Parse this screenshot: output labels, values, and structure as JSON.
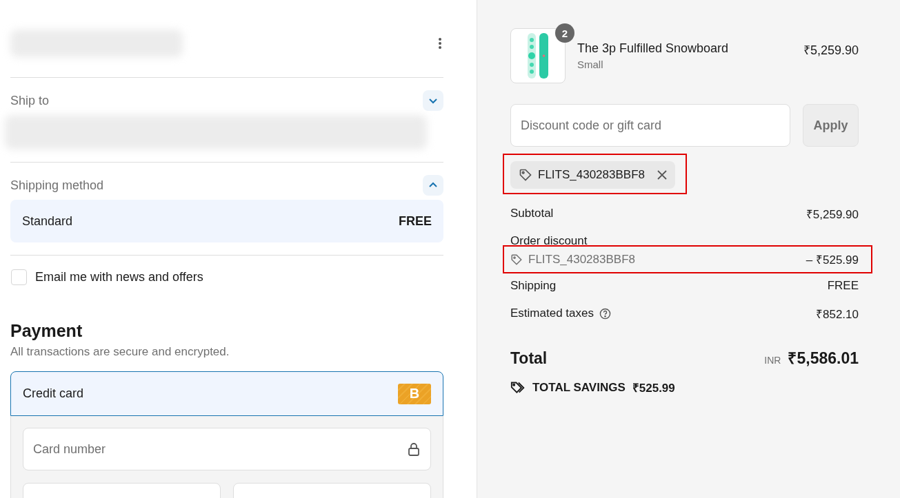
{
  "ship_to": {
    "label": "Ship to",
    "expanded": false
  },
  "shipping_method": {
    "label": "Shipping method",
    "expanded": true,
    "option": {
      "name": "Standard",
      "price": "FREE"
    }
  },
  "newsletter": {
    "label": "Email me with news and offers",
    "checked": false
  },
  "payment": {
    "title": "Payment",
    "subtitle": "All transactions are secure and encrypted.",
    "methods": [
      {
        "label": "Credit card",
        "badge": "B",
        "selected": true
      }
    ],
    "card_number": {
      "placeholder": "Card number"
    }
  },
  "order": {
    "item": {
      "name": "The 3p Fulfilled Snowboard",
      "variant": "Small",
      "quantity": "2",
      "price": "₹5,259.90"
    },
    "discount": {
      "placeholder": "Discount code or gift card",
      "button": "Apply"
    },
    "applied_codes": [
      {
        "code": "FLITS_430283BBF8",
        "highlighted": true
      }
    ],
    "lines": [
      {
        "kind": "plain",
        "label": "Subtotal",
        "value": "₹5,259.90"
      },
      {
        "kind": "discount",
        "label": "Order discount",
        "code": "FLITS_430283BBF8",
        "value": "– ₹525.99",
        "highlighted": true
      },
      {
        "kind": "plain",
        "label": "Shipping",
        "value": "FREE"
      },
      {
        "kind": "info",
        "label": "Estimated taxes",
        "value": "₹852.10"
      }
    ],
    "total": {
      "label": "Total",
      "currency": "INR",
      "value": "₹5,586.01"
    },
    "savings": {
      "label": "TOTAL SAVINGS",
      "value": "₹525.99"
    }
  }
}
